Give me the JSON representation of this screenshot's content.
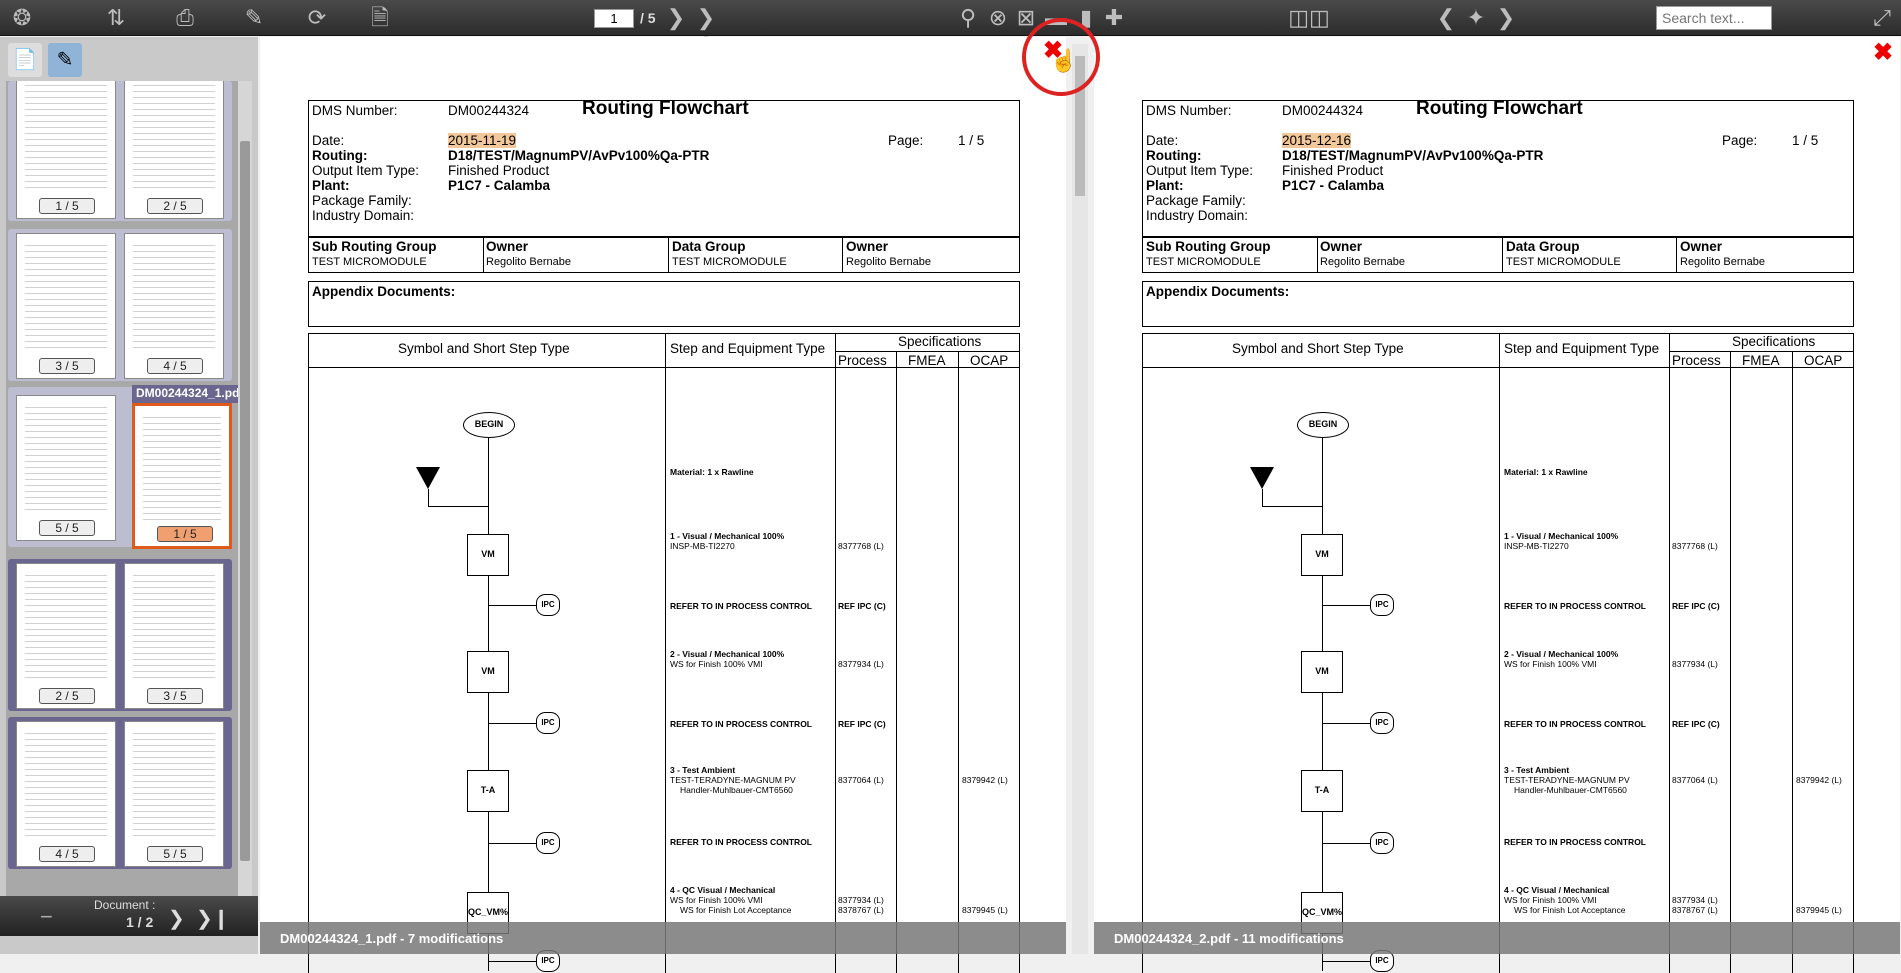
{
  "toolbar": {
    "page_current": "1",
    "page_total": "/ 5",
    "search_placeholder": "Search text...",
    "icons": [
      "app-logo-icon",
      "sort-icon",
      "scanner-icon",
      "edit-icon",
      "sync-icon",
      "report-icon",
      "zoom-in-icon",
      "zoom-reset-icon",
      "zoom-fit-icon",
      "fit-width-icon",
      "fit-height-icon",
      "fullscreen-icon",
      "compare-layout-icon",
      "prev-diff-icon",
      "diff-marker-icon",
      "next-diff-icon",
      "expand-icon"
    ]
  },
  "sidebar": {
    "tab_pages_icon": "page-icon",
    "tab_annot_icon": "annotation-icon",
    "highlighted_file": "DM00244324_1.pdf",
    "thumb_labels": [
      "1 / 5",
      "2 / 5",
      "3 / 5",
      "4 / 5",
      "5 / 5",
      "1 / 5",
      "2 / 5",
      "3 / 5",
      "4 / 5",
      "5 / 5"
    ],
    "document_label": "Document :",
    "document_index": "1 / 2"
  },
  "colors": {
    "toolbar": "#333333",
    "selected_thumb": "#e05a1a",
    "group_purple": "#6b6690",
    "date_highlight": "#f2c79a",
    "close_red": "#e00000"
  },
  "doc1": {
    "dms_label": "DMS Number:",
    "dms_value": "DM00244324",
    "title": "Routing Flowchart",
    "date_label": "Date:",
    "date_value": "2015-11-19",
    "page_label": "Page:",
    "page_value": "1 / 5",
    "routing_label": "Routing:",
    "routing_value": "D18/TEST/MagnumPV/AvPv100%Qa-PTR",
    "output_label": "Output Item Type:",
    "output_value": "Finished Product",
    "plant_label": "Plant:",
    "plant_value": "P1C7 - Calamba",
    "pkg_label": "Package Family:",
    "industry_label": "Industry Domain:",
    "col_sub": "Sub Routing Group",
    "col_owner": "Owner",
    "col_data": "Data Group",
    "col_owner2": "Owner",
    "sub_value": "TEST MICROMODULE",
    "owner_value": "Regolito Bernabe",
    "data_value": "TEST MICROMODULE",
    "owner2_value": "Regolito Bernabe",
    "appendix": "Appendix Documents:",
    "th_symbol": "Symbol and Short Step Type",
    "th_step": "Step and Equipment Type",
    "th_spec": "Specifications",
    "th_process": "Process",
    "th_fmea": "FMEA",
    "th_ocap": "OCAP",
    "footer": "DM00244324_1.pdf - 7 modifications",
    "steps": [
      {
        "title": "Material: 1 x Rawline",
        "sub": "",
        "process": "",
        "ocap": ""
      },
      {
        "title": "1 - Visual / Mechanical 100%",
        "sub": "INSP-MB-TI2270",
        "process": "8377768 (L)",
        "ocap": ""
      },
      {
        "title": "REFER TO IN PROCESS CONTROL",
        "sub": "",
        "process": "REF IPC (C)",
        "ocap": ""
      },
      {
        "title": "2 - Visual / Mechanical 100%",
        "sub": "WS for Finish 100% VMI",
        "process": "8377934 (L)",
        "ocap": ""
      },
      {
        "title": "REFER TO IN PROCESS CONTROL",
        "sub": "",
        "process": "REF IPC (C)",
        "ocap": ""
      },
      {
        "title": "3 - Test Ambient",
        "sub": "TEST-TERADYNE-MAGNUM PV",
        "sub2": "Handler-Muhlbauer-CMT6560",
        "process": "8377064 (L)",
        "ocap": "8379942 (L)"
      },
      {
        "title": "REFER TO IN PROCESS CONTROL",
        "sub": "",
        "process": "",
        "ocap": ""
      },
      {
        "title": "4 - QC Visual / Mechanical",
        "sub": "WS for Finish 100% VMI",
        "sub2": "WS for Finish Lot Acceptance",
        "process": "8377934 (L)",
        "process2": "8378767 (L)",
        "ocap": "8379945 (L)"
      }
    ],
    "shapes": {
      "begin": "BEGIN",
      "vm": "VM",
      "ipc": "IPC",
      "ta": "T-A",
      "qc": "QC_VM%"
    }
  },
  "doc2": {
    "dms_label": "DMS Number:",
    "dms_value": "DM00244324",
    "title": "Routing Flowchart",
    "date_label": "Date:",
    "date_value": "2015-12-16",
    "page_label": "Page:",
    "page_value": "1 / 5",
    "routing_label": "Routing:",
    "routing_value": "D18/TEST/MagnumPV/AvPv100%Qa-PTR",
    "output_label": "Output Item Type:",
    "output_value": "Finished Product",
    "plant_label": "Plant:",
    "plant_value": "P1C7 - Calamba",
    "pkg_label": "Package Family:",
    "industry_label": "Industry Domain:",
    "col_sub": "Sub Routing Group",
    "col_owner": "Owner",
    "col_data": "Data Group",
    "col_owner2": "Owner",
    "sub_value": "TEST MICROMODULE",
    "owner_value": "Regolito Bernabe",
    "data_value": "TEST MICROMODULE",
    "owner2_value": "Regolito Bernabe",
    "appendix": "Appendix Documents:",
    "th_symbol": "Symbol and Short Step Type",
    "th_step": "Step and Equipment Type",
    "th_spec": "Specifications",
    "th_process": "Process",
    "th_fmea": "FMEA",
    "th_ocap": "OCAP",
    "footer": "DM00244324_2.pdf - 11 modifications",
    "steps": [
      {
        "title": "Material: 1 x Rawline",
        "sub": "",
        "process": "",
        "ocap": ""
      },
      {
        "title": "1 - Visual / Mechanical 100%",
        "sub": "INSP-MB-TI2270",
        "process": "8377768 (L)",
        "ocap": ""
      },
      {
        "title": "REFER TO IN PROCESS CONTROL",
        "sub": "",
        "process": "REF IPC (C)",
        "ocap": ""
      },
      {
        "title": "2 - Visual / Mechanical 100%",
        "sub": "WS for Finish 100% VMI",
        "process": "8377934 (L)",
        "ocap": ""
      },
      {
        "title": "REFER TO IN PROCESS CONTROL",
        "sub": "",
        "process": "REF IPC (C)",
        "ocap": ""
      },
      {
        "title": "3 - Test Ambient",
        "sub": "TEST-TERADYNE-MAGNUM PV",
        "sub2": "Handler-Muhlbauer-CMT6560",
        "process": "8377064 (L)",
        "ocap": "8379942 (L)"
      },
      {
        "title": "REFER TO IN PROCESS CONTROL",
        "sub": "",
        "process": "",
        "ocap": ""
      },
      {
        "title": "4 - QC Visual / Mechanical",
        "sub": "WS for Finish 100% VMI",
        "sub2": "WS for Finish Lot Acceptance",
        "process": "8377934 (L)",
        "process2": "8378767 (L)",
        "ocap": "8379945 (L)"
      }
    ],
    "shapes": {
      "begin": "BEGIN",
      "vm": "VM",
      "ipc": "IPC",
      "ta": "T-A",
      "qc": "QC_VM%"
    }
  }
}
